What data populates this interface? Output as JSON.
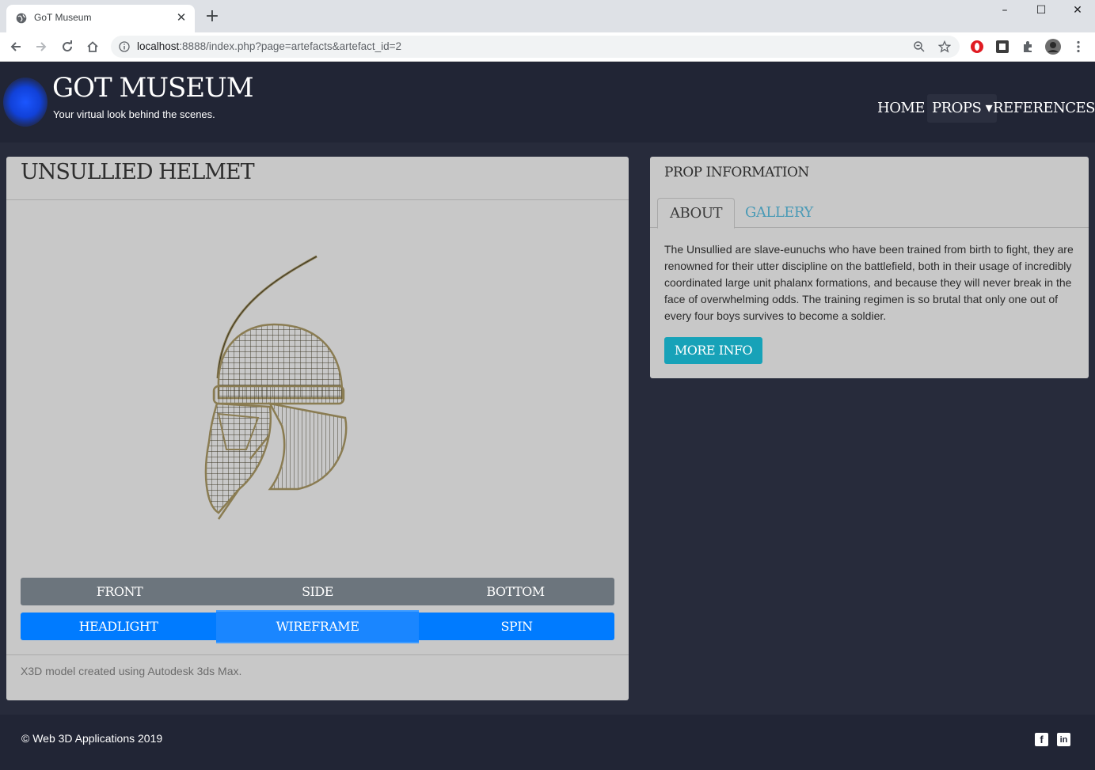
{
  "browser": {
    "tab_title": "GoT Museum",
    "tab_close": "✕",
    "new_tab": "+",
    "url_host": "localhost",
    "url_rest": ":8888/index.php?page=artefacts&artefact_id=2",
    "window_controls": {
      "minimize": "–",
      "maximize": "☐",
      "close": "✕"
    }
  },
  "header": {
    "brand": "GOT MUSEUM",
    "tagline": "Your virtual look behind the scenes.",
    "nav": {
      "home": "HOME",
      "props": "PROPS ▾",
      "references": "REFERENCES"
    }
  },
  "artefact": {
    "title": "UNSULLIED HELMET",
    "view_buttons": [
      "FRONT",
      "SIDE",
      "BOTTOM"
    ],
    "mode_buttons": [
      "HEADLIGHT",
      "WIREFRAME",
      "SPIN"
    ],
    "active_mode": "WIREFRAME",
    "footer_note": "X3D model created using Autodesk 3ds Max."
  },
  "info": {
    "title": "PROP INFORMATION",
    "tabs": [
      "ABOUT",
      "GALLERY"
    ],
    "active_tab": "ABOUT",
    "about_text": "The Unsullied are slave-eunuchs who have been trained from birth to fight, they are renowned for their utter discipline on the battlefield, both in their usage of incredibly coordinated large unit phalanx formations, and because they will never break in the face of overwhelming odds. The training regimen is so brutal that only one out of every four boys survives to become a soldier.",
    "more_button": "MORE INFO"
  },
  "footer": {
    "copyright": "© Web 3D Applications 2019",
    "facebook": "f",
    "linkedin": "in"
  },
  "colors": {
    "page_bg": "#272b3b",
    "header_bg": "#212535",
    "card_bg": "#c8c8c8",
    "secondary_btn": "#6c757d",
    "primary_btn": "#007bff",
    "info_btn": "#17a2b8",
    "tab_link": "#4a9ab6"
  },
  "icons": [
    "globe-icon",
    "back-arrow-icon",
    "forward-arrow-icon",
    "reload-icon",
    "home-icon",
    "info-icon",
    "zoom-icon",
    "star-icon",
    "extension-icon",
    "facebook-icon",
    "linkedin-icon"
  ]
}
